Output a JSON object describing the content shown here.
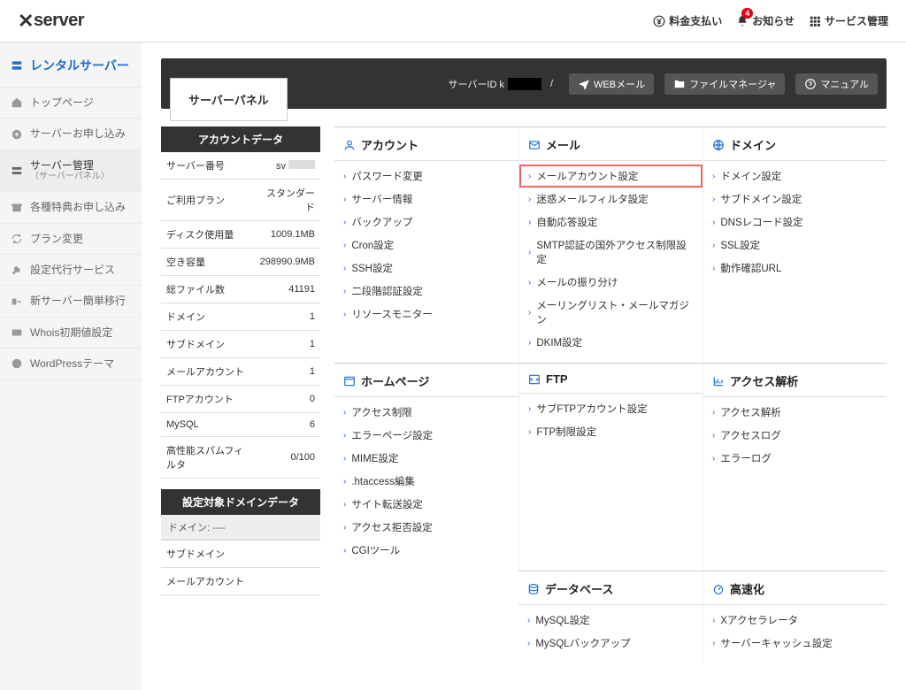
{
  "header": {
    "logo_main": "server",
    "pay": "料金支払い",
    "news": "お知らせ",
    "news_badge": "4",
    "svc": "サービス管理"
  },
  "sidebar": {
    "title": "レンタルサーバー",
    "items": [
      {
        "label": "トップページ"
      },
      {
        "label": "サーバーお申し込み"
      },
      {
        "label": "サーバー管理",
        "sub": "（サーバーパネル）"
      },
      {
        "label": "各種特典お申し込み"
      },
      {
        "label": "プラン変更"
      },
      {
        "label": "設定代行サービス"
      },
      {
        "label": "新サーバー簡単移行"
      },
      {
        "label": "Whois初期値設定"
      },
      {
        "label": "WordPressテーマ"
      }
    ]
  },
  "topbar": {
    "title": "サーバーパネル",
    "server_id_label": "サーバーID k",
    "slash": "/",
    "web": "WEBメール",
    "file": "ファイルマネージャ",
    "manual": "マニュアル"
  },
  "acct_block": {
    "title": "アカウントデータ",
    "rows": [
      {
        "k": "サーバー番号",
        "v": "sv"
      },
      {
        "k": "ご利用プラン",
        "v": "スタンダード"
      },
      {
        "k": "ディスク使用量",
        "v": "1009.1MB"
      },
      {
        "k": "空き容量",
        "v": "298990.9MB"
      },
      {
        "k": "総ファイル数",
        "v": "41191"
      },
      {
        "k": "ドメイン",
        "v": "1"
      },
      {
        "k": "サブドメイン",
        "v": "1"
      },
      {
        "k": "メールアカウント",
        "v": "1"
      },
      {
        "k": "FTPアカウント",
        "v": "0"
      },
      {
        "k": "MySQL",
        "v": "6"
      },
      {
        "k": "高性能スパムフィルタ",
        "v": "0/100"
      }
    ]
  },
  "dom_block": {
    "title": "設定対象ドメインデータ",
    "select": "ドメイン:  ----",
    "rows": [
      {
        "k": "サブドメイン",
        "v": ""
      },
      {
        "k": "メールアカウント",
        "v": ""
      }
    ]
  },
  "panels": [
    {
      "title": "アカウント",
      "icon": "user",
      "items": [
        "パスワード変更",
        "サーバー情報",
        "バックアップ",
        "Cron設定",
        "SSH設定",
        "二段階認証設定",
        "リソースモニター"
      ]
    },
    {
      "title": "メール",
      "icon": "mail",
      "items": [
        "メールアカウント設定",
        "迷惑メールフィルタ設定",
        "自動応答設定",
        "SMTP認証の国外アクセス制限設定",
        "メールの振り分け",
        "メーリングリスト・メールマガジン",
        "DKIM設定"
      ]
    },
    {
      "title": "ドメイン",
      "icon": "globe",
      "items": [
        "ドメイン設定",
        "サブドメイン設定",
        "DNSレコード設定",
        "SSL設定",
        "動作確認URL"
      ]
    },
    {
      "title": "ホームページ",
      "icon": "window",
      "items": [
        "アクセス制限",
        "エラーページ設定",
        "MIME設定",
        ".htaccess編集",
        "サイト転送設定",
        "アクセス拒否設定",
        "CGIツール"
      ]
    },
    {
      "title": "FTP",
      "icon": "ftp",
      "items": [
        "サブFTPアカウント設定",
        "FTP制限設定"
      ]
    },
    {
      "title": "アクセス解析",
      "icon": "chart",
      "items": [
        "アクセス解析",
        "アクセスログ",
        "エラーログ"
      ]
    },
    {
      "title": "データベース",
      "icon": "db",
      "items": [
        "MySQL設定",
        "MySQLバックアップ"
      ]
    },
    {
      "title": "高速化",
      "icon": "speed",
      "items": [
        "Xアクセラレータ",
        "サーバーキャッシュ設定"
      ]
    }
  ]
}
